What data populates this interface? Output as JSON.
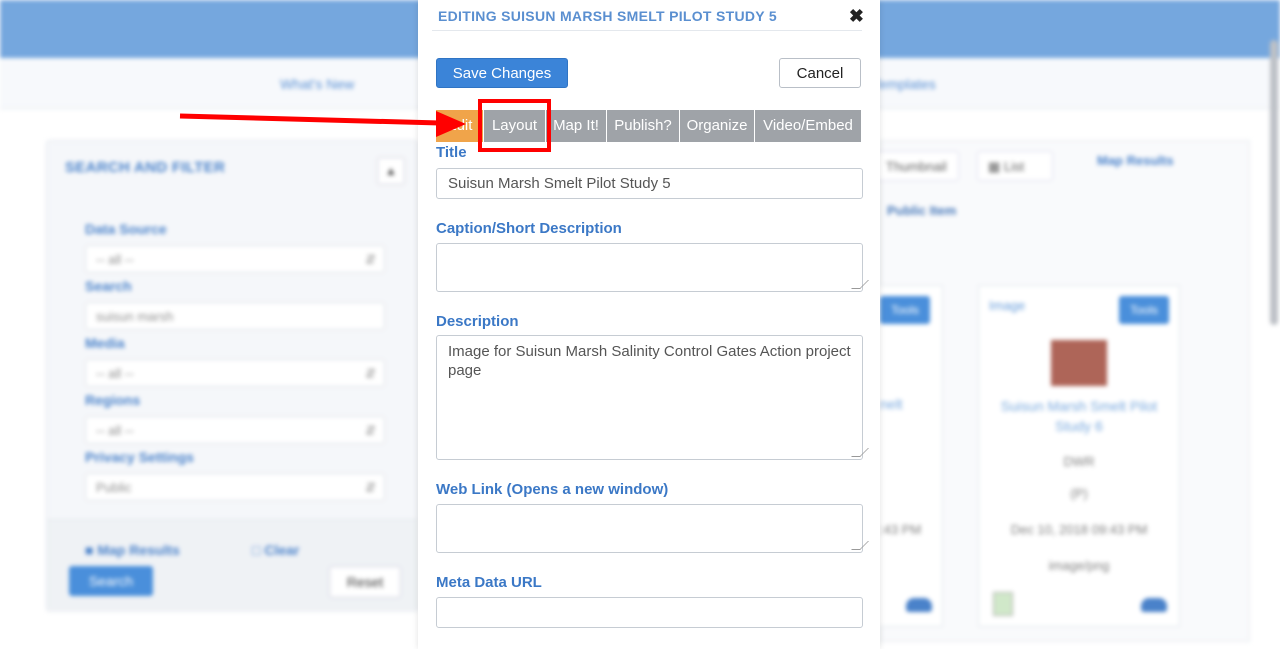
{
  "background": {
    "nav_items": [
      "What's New",
      "Templates"
    ],
    "sidebar": {
      "title": "SEARCH AND FILTER",
      "collapse_icon": "collapse-icon",
      "fields": [
        {
          "label": "Data Source",
          "value": "-- all --"
        },
        {
          "label": "Search",
          "value": "suisun marsh"
        },
        {
          "label": "Media",
          "value": "-- all --"
        },
        {
          "label": "Regions",
          "value": "-- all --"
        },
        {
          "label": "Privacy Settings",
          "value": "Public"
        }
      ],
      "map_results_label": "Map Results",
      "clear_label": "Clear",
      "search_button": "Search",
      "reset_button": "Reset"
    },
    "results": {
      "thumbnail_label": "Thumbnail",
      "list_label": "List",
      "map_results_link": "Map Results",
      "public_items_label": "Public Item",
      "card": {
        "type": "Image",
        "tools_label": "Tools",
        "title": "Suisun Marsh Smelt Pilot Study 6",
        "agency": "DWR",
        "id": "(P)",
        "date": "Dec 10, 2018 09:43 PM",
        "format": "image/png"
      },
      "left_card": {
        "tools_label": "Tools",
        "title_fragment": "nelt",
        "time_fragment": ":43 PM"
      }
    }
  },
  "modal": {
    "title": "EDITING SUISUN MARSH SMELT PILOT STUDY 5",
    "close_icon": "close-icon",
    "save_label": "Save Changes",
    "cancel_label": "Cancel",
    "tabs": [
      "Edit",
      "Layout",
      "Map It!",
      "Publish?",
      "Organize",
      "Video/Embed"
    ],
    "fields": {
      "title_label": "Title",
      "title_value": "Suisun Marsh Smelt Pilot Study 5",
      "caption_label": "Caption/Short Description",
      "caption_value": "",
      "description_label": "Description",
      "description_value": "Image for Suisun Marsh Salinity Control Gates Action project page",
      "weblink_label": "Web Link (Opens a new window)",
      "weblink_value": "",
      "metadata_label": "Meta Data URL",
      "metadata_value": ""
    }
  },
  "annotation": {
    "arrow_color": "#ff0000",
    "highlight_target": "Layout"
  }
}
